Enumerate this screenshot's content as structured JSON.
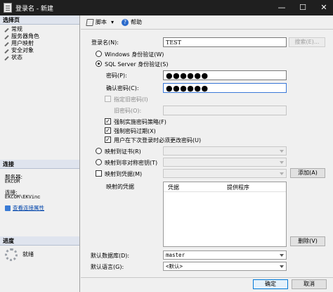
{
  "window": {
    "title": "登录名 - 新建",
    "min": "—",
    "max": "☐",
    "close": "✕"
  },
  "sidebar": {
    "select_page_header": "选择页",
    "pages": [
      {
        "label": "常规"
      },
      {
        "label": "服务器角色"
      },
      {
        "label": "用户映射"
      },
      {
        "label": "安全对象"
      },
      {
        "label": "状态"
      }
    ],
    "connection_header": "连接",
    "server_label": "服务器:",
    "server_value": "EKCOM",
    "connection_label": "连接:",
    "connection_value": "EKCOM\\EKVinc",
    "view_connection_link": "查看连接属性",
    "progress_header": "进度",
    "progress_status": "就绪"
  },
  "toolbar": {
    "script_label": "脚本",
    "help_label": "帮助",
    "script_dropdown": "▾"
  },
  "form": {
    "login_name_label": "登录名(N):",
    "login_name_value": "TEST",
    "search_button": "搜索(E)...",
    "windows_auth_label": "Windows 身份验证(W)",
    "sql_auth_label": "SQL Server 身份验证(S)",
    "password_label": "密码(P):",
    "password_value": "●●●●●●",
    "confirm_password_label": "确认密码(C):",
    "confirm_password_value": "●●●●●●",
    "specify_old_password_label": "指定旧密码(I)",
    "old_password_label": "旧密码(O):",
    "enforce_policy_label": "强制实施密码策略(F)",
    "enforce_expiration_label": "强制密码过期(X)",
    "must_change_label": "用户在下次登录时必须更改密码(U)",
    "mapped_certificate_label": "映射到证书(R)",
    "mapped_asym_key_label": "映射到非对称密钥(T)",
    "map_credential_label": "映射到凭据(M)",
    "add_button": "添加(A)",
    "mapped_credentials_label": "映射的凭据",
    "grid_columns": [
      "凭据",
      "提供程序"
    ],
    "remove_button": "删除(V)",
    "default_database_label": "默认数据库(D):",
    "default_database_value": "master",
    "default_language_label": "默认语言(G):",
    "default_language_value": "<默认>"
  },
  "footer": {
    "ok_button": "确定",
    "cancel_button": "取消"
  }
}
